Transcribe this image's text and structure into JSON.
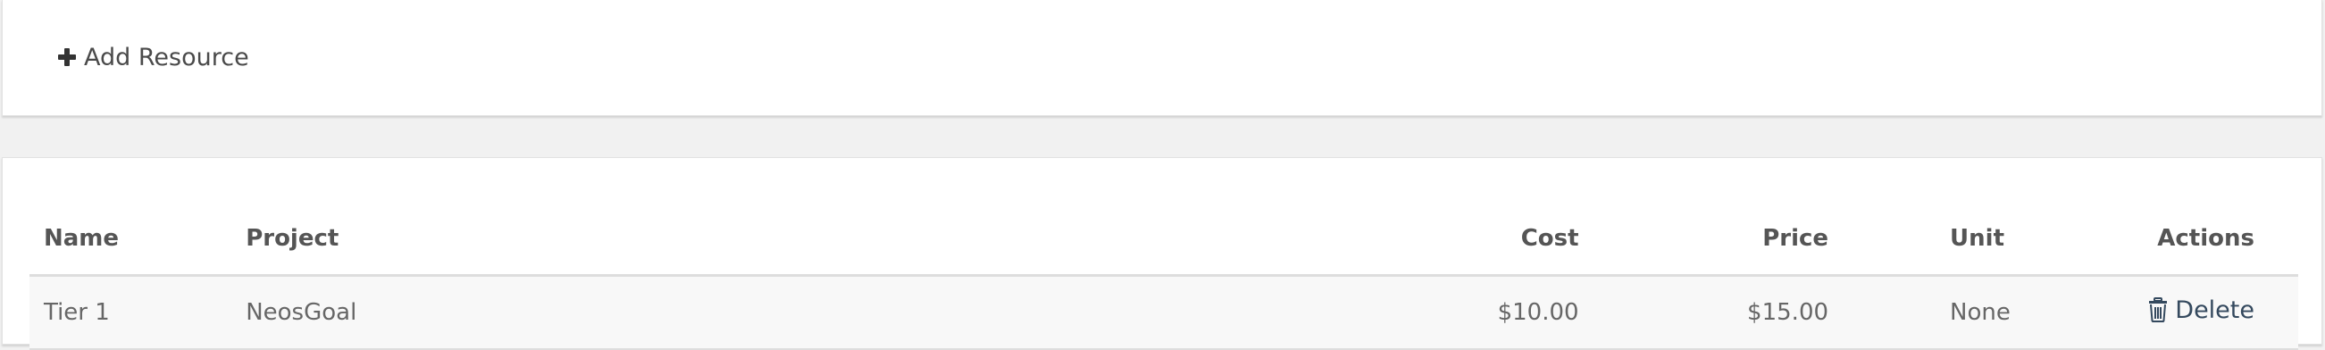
{
  "add_panel": {
    "add_button_label": "Add Resource"
  },
  "table": {
    "headers": {
      "name": "Name",
      "project": "Project",
      "cost": "Cost",
      "price": "Price",
      "unit": "Unit",
      "actions": "Actions"
    },
    "rows": [
      {
        "name": "Tier 1",
        "project": "NeosGoal",
        "cost": "$10.00",
        "price": "$15.00",
        "unit": "None",
        "action_label": "Delete"
      }
    ]
  },
  "icons": {
    "add": "plus-icon",
    "delete": "trash-icon"
  },
  "colors": {
    "page_background": "#f1f1f1",
    "panel_background": "#ffffff",
    "row_background": "#f8f8f8",
    "link_color": "#34495e",
    "text_color": "#666666"
  }
}
